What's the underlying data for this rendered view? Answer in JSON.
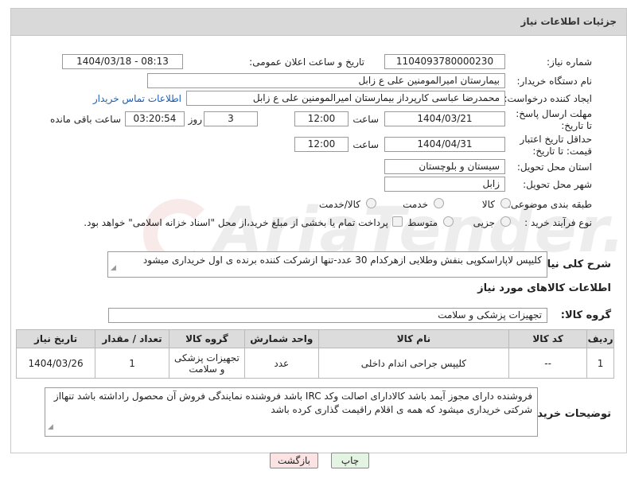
{
  "header": {
    "title": "جزئیات اطلاعات نیاز"
  },
  "fields": {
    "need_number_label": "شماره نیاز:",
    "need_number": "1104093780000230",
    "announce_label": "تاریخ و ساعت اعلان عمومی:",
    "announce_value": "1404/03/18 - 08:13",
    "buyer_org_label": "نام دستگاه خریدار:",
    "buyer_org": "بیمارستان امیرالمومنین علی  ع  زابل",
    "creator_label": "ایجاد کننده درخواست:",
    "creator": "محمدرضا عباسی کارپرداز بیمارستان امیرالمومنین علی  ع  زابل",
    "contact_link": "اطلاعات تماس خریدار",
    "deadline_label": "مهلت ارسال پاسخ: تا تاریخ:",
    "deadline_date": "1404/03/21",
    "time_word": "ساعت",
    "deadline_time": "12:00",
    "days": "3",
    "days_word": "روز و",
    "remaining_time": "03:20:54",
    "remaining_word": "ساعت باقی مانده",
    "price_validity_label": "حداقل تاریخ اعتبار قیمت: تا تاریخ:",
    "price_validity_date": "1404/04/31",
    "price_validity_time": "12:00",
    "province_label": "استان محل تحویل:",
    "province": "سیستان و بلوچستان",
    "city_label": "شهر محل تحویل:",
    "city": "زابل",
    "category_label": "طبقه بندی موضوعی:",
    "category_options": [
      "کالا",
      "خدمت",
      "کالا/خدمت"
    ],
    "process_label": "نوع فرآیند خرید :",
    "process_options": [
      "جزیی",
      "متوسط"
    ],
    "payment_note": "پرداخت تمام یا بخشی از مبلغ خرید،از محل \"اسناد خزانه اسلامی\" خواهد بود."
  },
  "description": {
    "label": "شرح کلی نیاز:",
    "text": "کلیپس لاپاراسکوپی بنفش وطلایی ازهرکدام 30 عدد-تنها ازشرکت کننده برنده ی اول خریداری میشود"
  },
  "goods_section": {
    "title": "اطلاعات کالاهای مورد نیاز",
    "group_label": "گروه کالا:",
    "group_value": "تجهیزات پزشکی و سلامت"
  },
  "table": {
    "headers": [
      "ردیف",
      "کد کالا",
      "نام کالا",
      "واحد شمارش",
      "گروه کالا",
      "تعداد / مقدار",
      "تاریخ نیاز"
    ],
    "rows": [
      [
        "1",
        "--",
        "کلیپس جراحی اندام داخلی",
        "عدد",
        "تجهیزات پزشکی و سلامت",
        "1",
        "1404/03/26"
      ]
    ]
  },
  "buyer_notes": {
    "label": "توضیحات خریدار:",
    "text": "فروشنده دارای مجوز آیمد باشد کالادارای اصالت وکد IRC  باشد فروشنده نمایندگی فروش آن محصول راداشته باشد تنهااز شرکتی خریداری میشود که همه ی اقلام راقیمت گذاری کرده باشد"
  },
  "buttons": {
    "print": "چاپ",
    "back": "بازگشت"
  },
  "watermark": {
    "text": "AriaTender.net"
  }
}
